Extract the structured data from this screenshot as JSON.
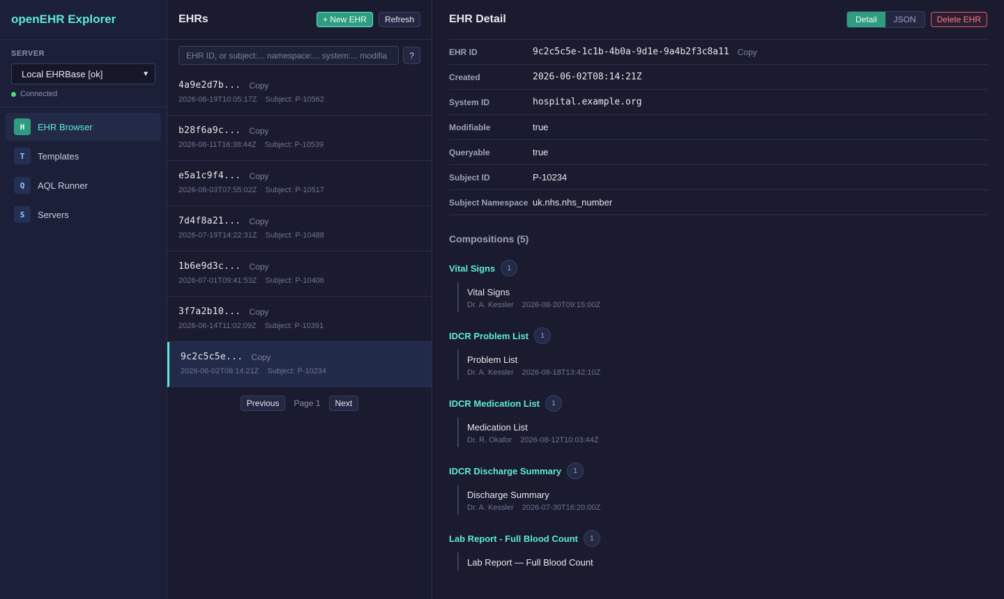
{
  "app": {
    "title": "openEHR Explorer"
  },
  "server": {
    "label": "SERVER",
    "selected": "Local EHRBase [ok]",
    "status": "Connected"
  },
  "nav": [
    {
      "letter": "H",
      "label": "EHR Browser"
    },
    {
      "letter": "T",
      "label": "Templates"
    },
    {
      "letter": "Q",
      "label": "AQL Runner"
    },
    {
      "letter": "S",
      "label": "Servers"
    }
  ],
  "list": {
    "title": "EHRs",
    "new_label": "+ New EHR",
    "refresh_label": "Refresh",
    "search_placeholder": "EHR ID, or subject:... namespace:... system:... modifia",
    "help_label": "?",
    "copy_label": "Copy",
    "rows": [
      {
        "id": "4a9e2d7b...",
        "time": "2026-08-19T10:05:17Z",
        "subject": "Subject: P-10562"
      },
      {
        "id": "b28f6a9c...",
        "time": "2026-08-11T16:38:44Z",
        "subject": "Subject: P-10539"
      },
      {
        "id": "e5a1c9f4...",
        "time": "2026-08-03T07:55:02Z",
        "subject": "Subject: P-10517"
      },
      {
        "id": "7d4f8a21...",
        "time": "2026-07-19T14:22:31Z",
        "subject": "Subject: P-10488"
      },
      {
        "id": "1b6e9d3c...",
        "time": "2026-07-01T09:41:53Z",
        "subject": "Subject: P-10406"
      },
      {
        "id": "3f7a2b10...",
        "time": "2026-06-14T11:02:09Z",
        "subject": "Subject: P-10391"
      },
      {
        "id": "9c2c5c5e...",
        "time": "2026-06-02T08:14:21Z",
        "subject": "Subject: P-10234"
      }
    ],
    "pager": {
      "prev": "Previous",
      "page": "Page 1",
      "next": "Next"
    }
  },
  "detail": {
    "title": "EHR Detail",
    "tab_detail": "Detail",
    "tab_json": "JSON",
    "delete_label": "Delete EHR",
    "fields": [
      {
        "key": "EHR ID",
        "value": "9c2c5c5e-1c1b-4b0a-9d1e-9a4b2f3c8a11",
        "mono": true,
        "copy": "Copy"
      },
      {
        "key": "Created",
        "value": "2026-06-02T08:14:21Z",
        "mono": true
      },
      {
        "key": "System ID",
        "value": "hospital.example.org",
        "mono": true
      },
      {
        "key": "Modifiable",
        "value": "true"
      },
      {
        "key": "Queryable",
        "value": "true"
      },
      {
        "key": "Subject ID",
        "value": "P-10234"
      },
      {
        "key": "Subject Namespace",
        "value": "uk.nhs.nhs_number"
      }
    ],
    "compositions_title": "Compositions (5)",
    "groups": [
      {
        "title": "Vital Signs",
        "count": "1",
        "item": "Vital Signs",
        "author": "Dr. A. Kessler",
        "time": "2026-08-20T09:15:00Z"
      },
      {
        "title": "IDCR Problem List",
        "count": "1",
        "item": "Problem List",
        "author": "Dr. A. Kessler",
        "time": "2026-08-18T13:42:10Z"
      },
      {
        "title": "IDCR Medication List",
        "count": "1",
        "item": "Medication List",
        "author": "Dr. R. Okafor",
        "time": "2026-08-12T10:03:44Z"
      },
      {
        "title": "IDCR Discharge Summary",
        "count": "1",
        "item": "Discharge Summary",
        "author": "Dr. A. Kessler",
        "time": "2026-07-30T16:20:00Z"
      },
      {
        "title": "Lab Report - Full Blood Count",
        "count": "1",
        "item": "Lab Report — Full Blood Count",
        "author": "",
        "time": ""
      }
    ]
  }
}
